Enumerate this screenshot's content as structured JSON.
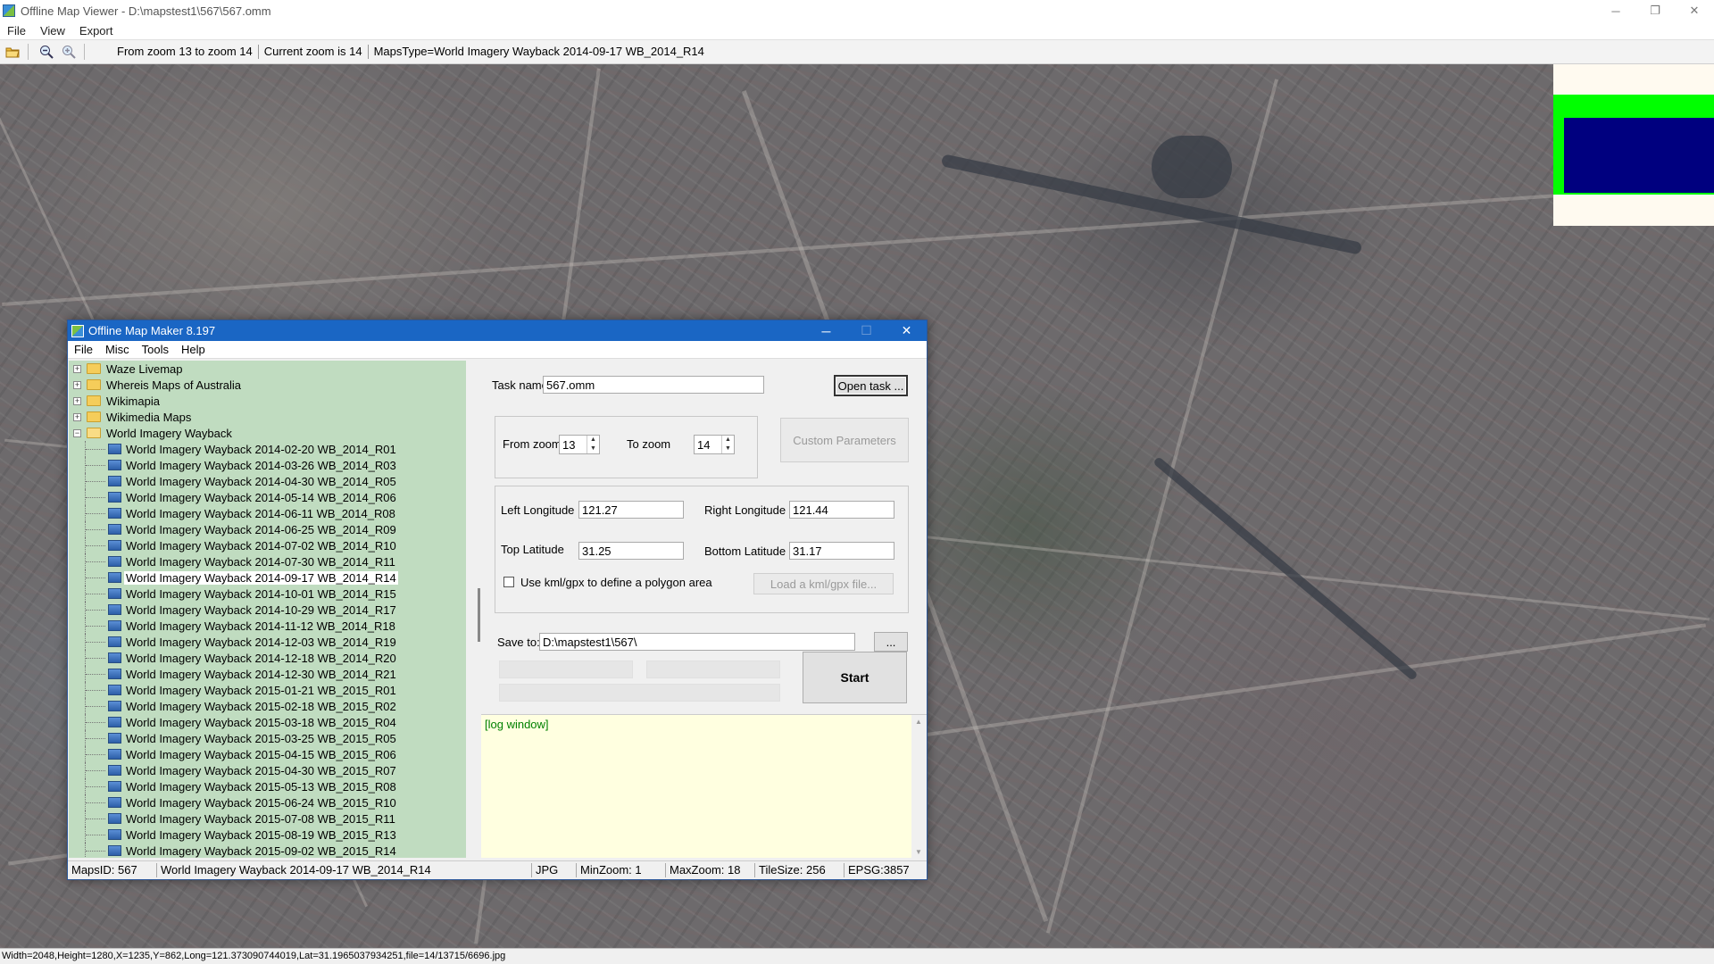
{
  "window": {
    "title": "Offline Map Viewer - D:\\mapstest1\\567\\567.omm",
    "controls": {
      "minimize": "─",
      "restore": "❐",
      "close": "✕"
    }
  },
  "menu": [
    "File",
    "View",
    "Export"
  ],
  "toolbar": {
    "status": [
      "From zoom 13 to zoom 14",
      "Current zoom is 14",
      "MapsType=World Imagery Wayback 2014-09-17 WB_2014_R14"
    ]
  },
  "status_bar": "Width=2048,Height=1280,X=1235,Y=862,Long=121.373090744019,Lat=31.1965037934251,file=14/13715/6696.jpg",
  "dialog": {
    "title": "Offline Map Maker 8.197",
    "controls": {
      "minimize": "─",
      "maximize": "☐",
      "close": "✕"
    },
    "menu": [
      "File",
      "Misc",
      "Tools",
      "Help"
    ],
    "tree": {
      "folders": [
        {
          "label": "Waze Livemap",
          "expanded": false
        },
        {
          "label": "Whereis Maps of Australia",
          "expanded": false
        },
        {
          "label": "Wikimapia",
          "expanded": false
        },
        {
          "label": "Wikimedia Maps",
          "expanded": false
        },
        {
          "label": "World Imagery Wayback",
          "expanded": true
        }
      ],
      "selected": "World Imagery Wayback 2014-09-17 WB_2014_R14",
      "items": [
        "World Imagery Wayback 2014-02-20 WB_2014_R01",
        "World Imagery Wayback 2014-03-26 WB_2014_R03",
        "World Imagery Wayback 2014-04-30 WB_2014_R05",
        "World Imagery Wayback 2014-05-14 WB_2014_R06",
        "World Imagery Wayback 2014-06-11 WB_2014_R08",
        "World Imagery Wayback 2014-06-25 WB_2014_R09",
        "World Imagery Wayback 2014-07-02 WB_2014_R10",
        "World Imagery Wayback 2014-07-30 WB_2014_R11",
        "World Imagery Wayback 2014-09-17 WB_2014_R14",
        "World Imagery Wayback 2014-10-01 WB_2014_R15",
        "World Imagery Wayback 2014-10-29 WB_2014_R17",
        "World Imagery Wayback 2014-11-12 WB_2014_R18",
        "World Imagery Wayback 2014-12-03 WB_2014_R19",
        "World Imagery Wayback 2014-12-18 WB_2014_R20",
        "World Imagery Wayback 2014-12-30 WB_2014_R21",
        "World Imagery Wayback 2015-01-21 WB_2015_R01",
        "World Imagery Wayback 2015-02-18 WB_2015_R02",
        "World Imagery Wayback 2015-03-18 WB_2015_R04",
        "World Imagery Wayback 2015-03-25 WB_2015_R05",
        "World Imagery Wayback 2015-04-15 WB_2015_R06",
        "World Imagery Wayback 2015-04-30 WB_2015_R07",
        "World Imagery Wayback 2015-05-13 WB_2015_R08",
        "World Imagery Wayback 2015-06-24 WB_2015_R10",
        "World Imagery Wayback 2015-07-08 WB_2015_R11",
        "World Imagery Wayback 2015-08-19 WB_2015_R13",
        "World Imagery Wayback 2015-09-02 WB_2015_R14"
      ]
    },
    "form": {
      "task_name_label": "Task name",
      "task_name_value": "567.omm",
      "open_task_label": "Open task ...",
      "from_zoom_label": "From zoom",
      "from_zoom_value": "13",
      "to_zoom_label": "To zoom",
      "to_zoom_value": "14",
      "custom_params_label": "Custom Parameters",
      "left_lon_label": "Left Longitude",
      "left_lon_value": "121.27",
      "right_lon_label": "Right Longitude",
      "right_lon_value": "121.44",
      "top_lat_label": "Top Latitude",
      "top_lat_value": "31.25",
      "bottom_lat_label": "Bottom Latitude",
      "bottom_lat_value": "31.17",
      "kml_checkbox_label": "Use kml/gpx to define a polygon area",
      "kml_checked": false,
      "load_kml_label": "Load a kml/gpx file...",
      "save_to_label": "Save to:",
      "save_to_value": "D:\\mapstest1\\567\\",
      "browse_label": "...",
      "start_label": "Start"
    },
    "log": "[log window]",
    "status": [
      "MapsID: 567",
      "World Imagery Wayback 2014-09-17 WB_2014_R14",
      "JPG",
      "MinZoom: 1",
      "MaxZoom: 18",
      "TileSize: 256",
      "EPSG:3857"
    ]
  },
  "colors": {
    "dialog_title_bg": "#1a66c4",
    "tree_bg": "#c0dcc0",
    "log_bg": "#ffffe0",
    "log_text": "#008000",
    "minimap_bg": "#fffaf0",
    "minimap_frame": "#00ff00",
    "minimap_view": "#00007f"
  }
}
